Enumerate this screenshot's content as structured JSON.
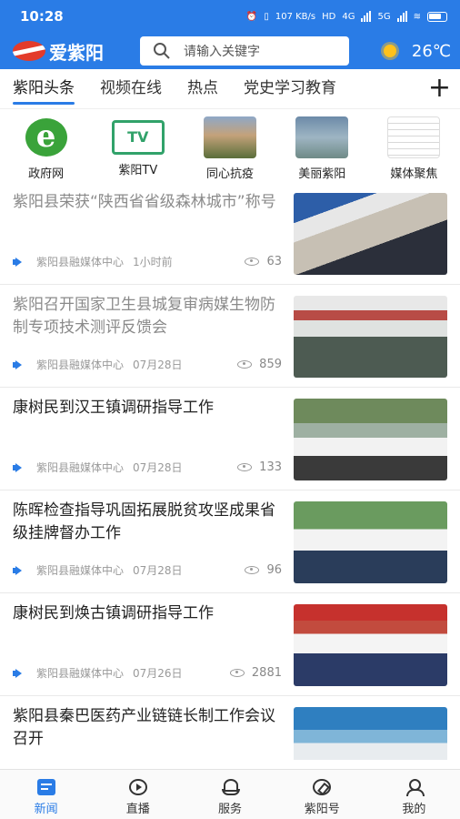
{
  "status_bar": {
    "time": "10:28",
    "net_speed": "107 KB/s",
    "hd": "HD",
    "net_type": "4G",
    "net_type2": "5G"
  },
  "app": {
    "name": "爱紫阳",
    "search_placeholder": "请输入关键字",
    "temperature": "26℃"
  },
  "tabs": [
    {
      "label": "紫阳头条",
      "active": true
    },
    {
      "label": "视频在线",
      "active": false
    },
    {
      "label": "热点",
      "active": false
    },
    {
      "label": "党史学习教育",
      "active": false
    }
  ],
  "shortcuts": [
    {
      "label": "政府网",
      "icon": "ie-browser-icon"
    },
    {
      "label": "紫阳TV",
      "icon": "tv-icon",
      "icon_text": "TV"
    },
    {
      "label": "同心抗疫",
      "icon": "photo-thumbnail"
    },
    {
      "label": "美丽紫阳",
      "icon": "photo-thumbnail"
    },
    {
      "label": "媒体聚焦",
      "icon": "newspaper-thumbnail"
    }
  ],
  "news": [
    {
      "title": "紫阳县荣获“陕西省省级森林城市”称号",
      "source": "紫阳县融媒体中心",
      "time": "1小时前",
      "views": "63",
      "read": true
    },
    {
      "title": "紫阳召开国家卫生县城复审病媒生物防制专项技术测评反馈会",
      "source": "紫阳县融媒体中心",
      "time": "07月28日",
      "views": "859",
      "read": true
    },
    {
      "title": "康树民到汉王镇调研指导工作",
      "source": "紫阳县融媒体中心",
      "time": "07月28日",
      "views": "133",
      "read": false
    },
    {
      "title": "陈晖检查指导巩固拓展脱贫攻坚成果省级挂牌督办工作",
      "source": "紫阳县融媒体中心",
      "time": "07月28日",
      "views": "96",
      "read": false
    },
    {
      "title": "康树民到焕古镇调研指导工作",
      "source": "紫阳县融媒体中心",
      "time": "07月26日",
      "views": "2881",
      "read": false
    },
    {
      "title": "紫阳县秦巴医药产业链链长制工作会议召开",
      "source": "",
      "time": "",
      "views": "",
      "read": false
    }
  ],
  "bottom_nav": [
    {
      "label": "新闻",
      "active": true
    },
    {
      "label": "直播",
      "active": false
    },
    {
      "label": "服务",
      "active": false
    },
    {
      "label": "紫阳号",
      "active": false
    },
    {
      "label": "我的",
      "active": false
    }
  ],
  "colors": {
    "brand_blue": "#2a7ce6",
    "logo_red": "#e33b2b",
    "sun_yellow": "#ffc21b"
  }
}
